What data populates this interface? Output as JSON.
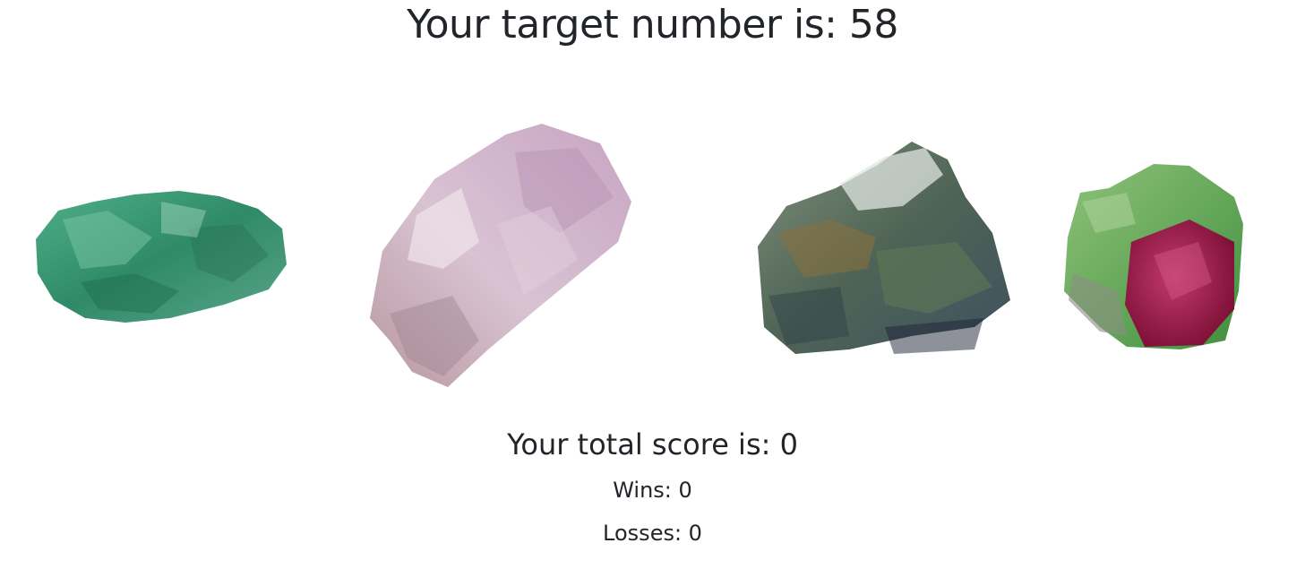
{
  "header": {
    "target_label": "Your target number is: 58"
  },
  "crystals": [
    {
      "icon": "green-aventurine-crystal",
      "color": "#3f9a7a"
    },
    {
      "icon": "pink-kunzite-crystal",
      "color": "#c9a3bf"
    },
    {
      "icon": "gray-green-rock-crystal",
      "color": "#5c6e5e"
    },
    {
      "icon": "ruby-zoisite-crystal",
      "color": "#a3204e"
    }
  ],
  "stats": {
    "score_label": "Your total score is: 0",
    "wins_label": "Wins: 0",
    "losses_label": "Losses: 0"
  }
}
